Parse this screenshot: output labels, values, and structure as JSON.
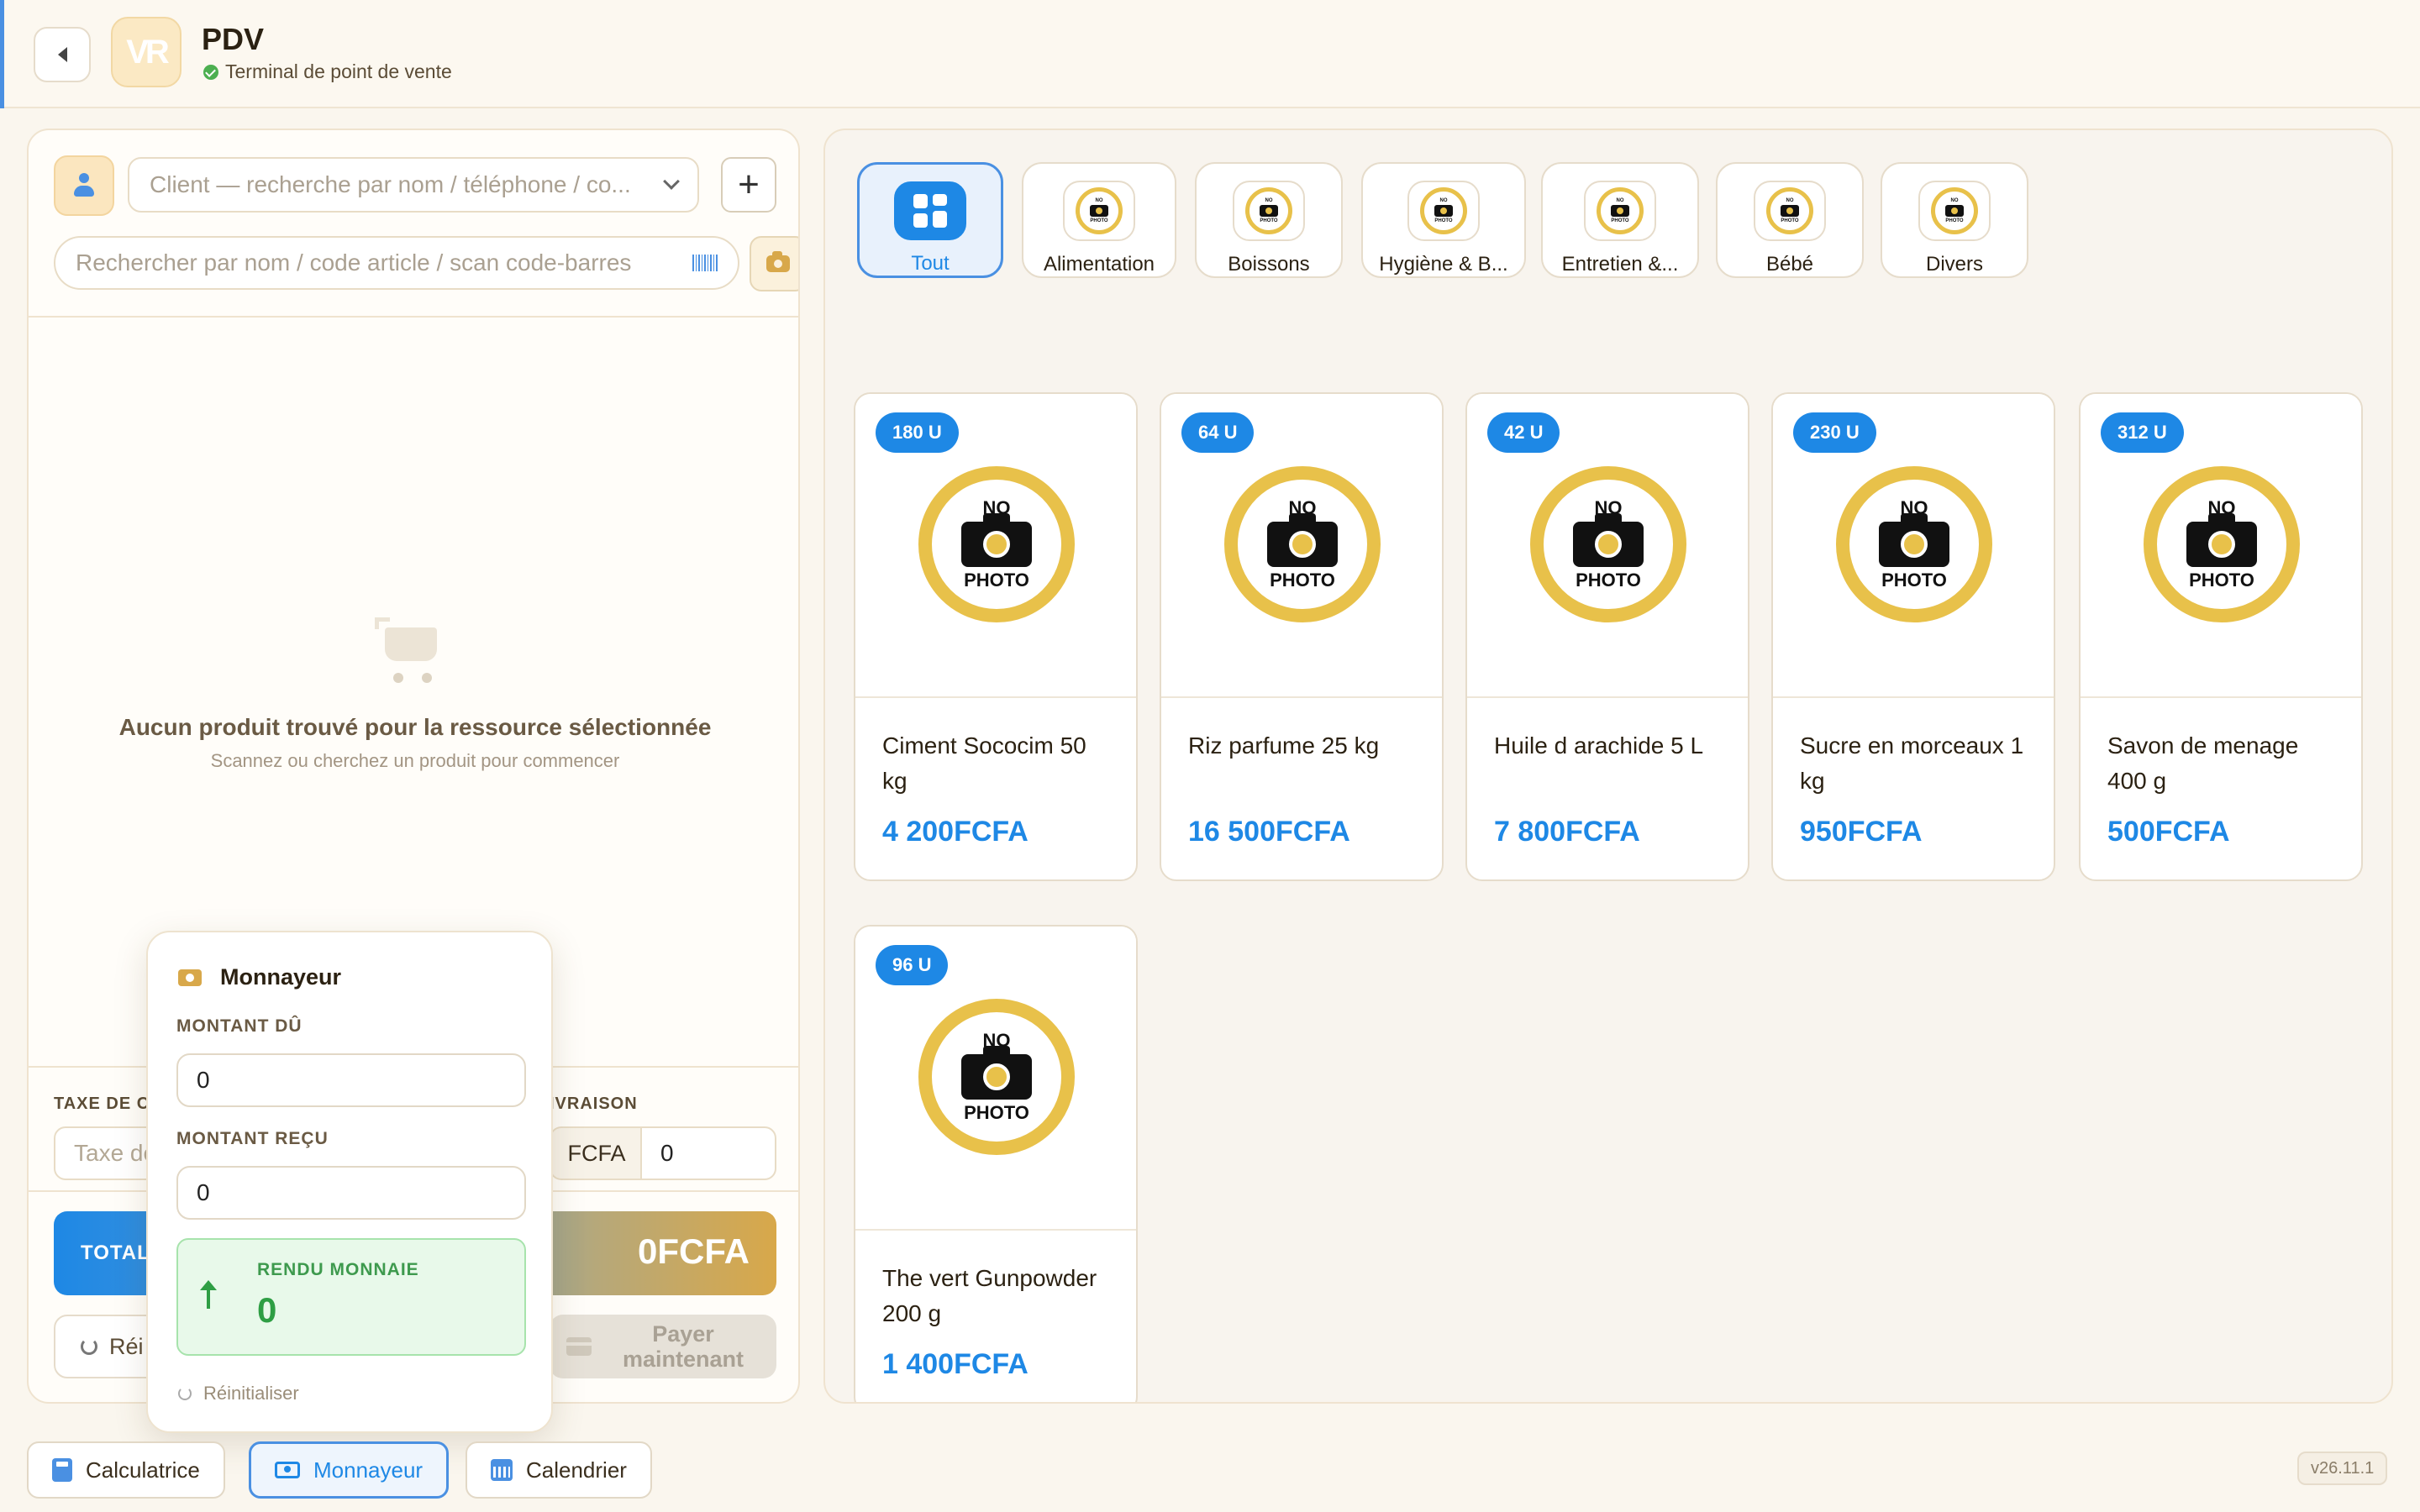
{
  "header": {
    "title": "PDV",
    "subtitle": "Terminal de point de vente",
    "logo_text": "VR"
  },
  "client": {
    "placeholder": "Client — recherche par nom / téléphone / co..."
  },
  "search": {
    "placeholder": "Rechercher par nom / code article / scan code-barres"
  },
  "cart": {
    "empty_title": "Aucun produit trouvé pour la ressource sélectionnée",
    "empty_subtitle": "Scannez ou cherchez un produit pour commencer"
  },
  "tax": {
    "label": "TAXE DE C",
    "placeholder": "Taxe de"
  },
  "delivery": {
    "label": "IVRAISON",
    "currency": "FCFA",
    "value": "0"
  },
  "total": {
    "label": "TOTAL",
    "value": "0FCFA"
  },
  "actions": {
    "reset_label": "Réi",
    "pay_label": "Payer maintenant"
  },
  "change_popup": {
    "title": "Monnayeur",
    "amount_due_label": "MONTANT DÛ",
    "amount_due_value": "0",
    "amount_received_label": "MONTANT REÇU",
    "amount_received_value": "0",
    "change_label": "RENDU MONNAIE",
    "change_value": "0",
    "reset_label": "Réinitialiser"
  },
  "categories": [
    {
      "label": "Tout",
      "active": true
    },
    {
      "label": "Alimentation"
    },
    {
      "label": "Boissons"
    },
    {
      "label": "Hygiène & B..."
    },
    {
      "label": "Entretien &..."
    },
    {
      "label": "Bébé"
    },
    {
      "label": "Divers"
    }
  ],
  "no_photo": {
    "top": "NO",
    "bottom": "PHOTO"
  },
  "products": [
    {
      "stock": "180 U",
      "name": "Ciment Sococim 50 kg",
      "price": "4 200FCFA"
    },
    {
      "stock": "64 U",
      "name": "Riz parfume 25 kg",
      "price": "16 500FCFA"
    },
    {
      "stock": "42 U",
      "name": "Huile d arachide 5 L",
      "price": "7 800FCFA"
    },
    {
      "stock": "230 U",
      "name": "Sucre en morceaux 1 kg",
      "price": "950FCFA"
    },
    {
      "stock": "312 U",
      "name": "Savon de menage 400 g",
      "price": "500FCFA"
    },
    {
      "stock": "96 U",
      "name": "The vert Gunpowder 200 g",
      "price": "1 400FCFA"
    }
  ],
  "bottom_bar": {
    "calculator": "Calculatrice",
    "change": "Monnayeur",
    "calendar": "Calendrier",
    "version": "v26.11.1"
  },
  "colors": {
    "accent": "#1e88e5",
    "brand_gold": "#d8a84a",
    "success": "#2e9e44",
    "background": "#faf6ee"
  }
}
